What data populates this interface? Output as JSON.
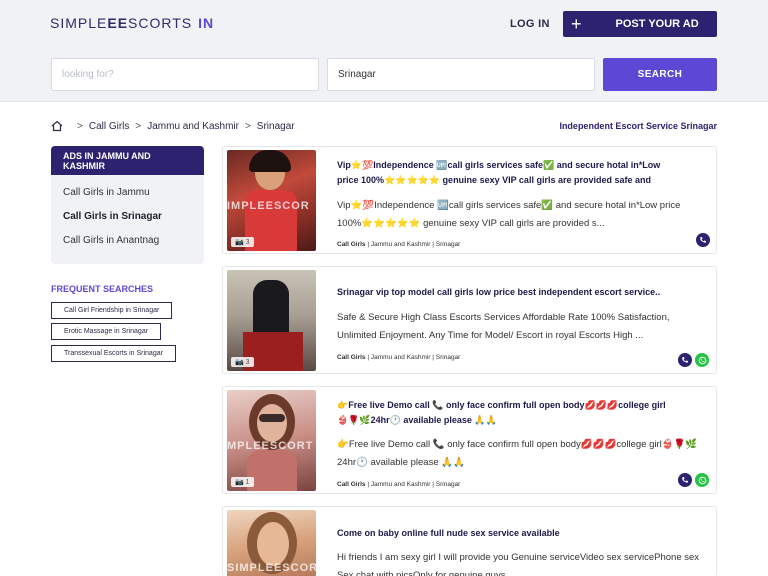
{
  "header": {
    "logo_main": "SIMPLE",
    "logo_ee": "EE",
    "logo_rest": "SCORTS",
    "logo_in": "IN",
    "login": "LOG IN",
    "post_ad": "POST YOUR AD"
  },
  "search": {
    "keyword_placeholder": "looking for?",
    "location_value": "Srinagar",
    "button": "SEARCH"
  },
  "breadcrumb": {
    "items": [
      "Call Girls",
      "Jammu and Kashmir",
      "Srinagar"
    ],
    "tagline": "Independent Escort Service Srinagar"
  },
  "sidebar": {
    "ads_heading": "ADS IN JAMMU AND KASHMIR",
    "links": [
      "Call Girls in Jammu",
      "Call Girls in Srinagar",
      "Call Girls in Anantnag"
    ],
    "frequent_title": "FREQUENT SEARCHES",
    "tags": [
      "Call Girl Friendship in Srinagar",
      "Erotic Massage in Srinagar",
      "Transsexual Escorts in Srinagar"
    ]
  },
  "listings": [
    {
      "title": "Vip⭐💯Independence 🆙call girls services safe✅ and secure hotal in*Low price 100%⭐⭐⭐⭐⭐ genuine sexy VIP call girls are provided safe and",
      "desc": "Vip⭐💯Independence 🆙call girls services safe✅ and secure hotal in*Low price 100%⭐⭐⭐⭐⭐ genuine sexy VIP call girls are provided s...",
      "category": "Call Girls",
      "region": "Jammu and Kashmir",
      "city": "Srinagar",
      "photos": "3",
      "watermark": "IMPLEESCOR"
    },
    {
      "title": "Srinagar vip top model call girls low price best independent escort service..",
      "desc": "Safe & Secure High Class Escorts Services Affordable Rate 100% Satisfaction, Unlimited Enjoyment. Any Time for Model/ Escort in royal Escorts High ...",
      "category": "Call Girls",
      "region": "Jammu and Kashmir",
      "city": "Srinagar",
      "photos": "3",
      "watermark": ""
    },
    {
      "title": "👉Free live Demo call 📞 only face confirm full open body💋💋💋college girl👙🌹🌿24hr🕐 available please 🙏🙏",
      "desc": "👉Free live Demo call 📞 only face confirm full open body💋💋💋college girl👙🌹🌿24hr🕐 available please 🙏🙏",
      "category": "Call Girls",
      "region": "Jammu and Kashmir",
      "city": "Srinagar",
      "photos": "1",
      "watermark": "MPLEESCORT"
    },
    {
      "title": "Come on baby online full nude sex service available",
      "desc": "Hi friends I am sexy girl I will provide you Genuine serviceVideo sex servicePhone sex Sex chat with picsOnly for genuine guys",
      "category": "",
      "region": "",
      "city": "",
      "photos": "",
      "watermark": "SIMPLEESCORTS"
    }
  ],
  "colors": {
    "brand_dark": "#2c2270",
    "accent": "#5b49d6",
    "whatsapp": "#25c245"
  }
}
